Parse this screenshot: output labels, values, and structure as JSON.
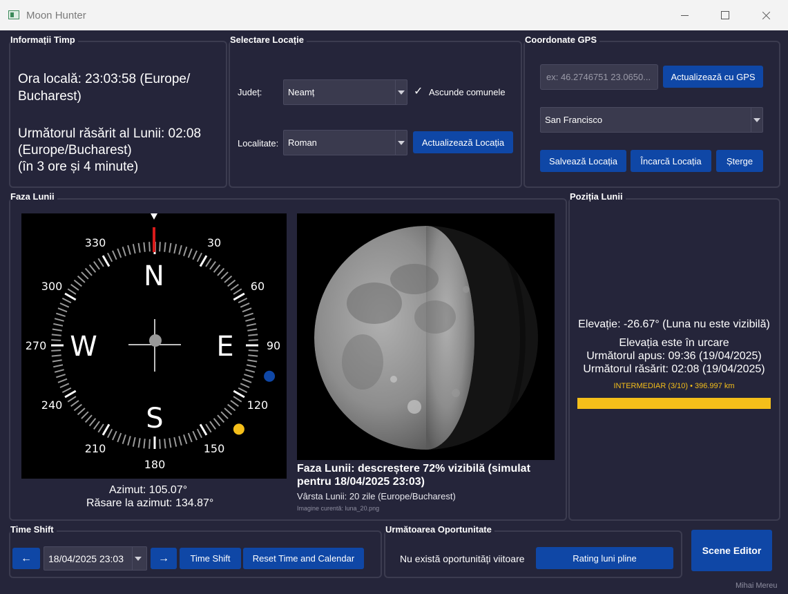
{
  "window": {
    "title": "Moon Hunter"
  },
  "time_info": {
    "group_title": "Informații Timp",
    "local_time_line1": "Ora locală: 23:03:58 (Europe/",
    "local_time_line2": "Bucharest)",
    "next_rise_line1": "Următorul răsărit al Lunii: 02:08",
    "next_rise_line2": "(Europe/Bucharest)",
    "next_rise_line3": "(în 3 ore și 4 minute)"
  },
  "location": {
    "group_title": "Selectare Locație",
    "county_label": "Județ:",
    "county_value": "Neamț",
    "hide_communes_label": "Ascunde comunele",
    "hide_communes_checked": true,
    "locality_label": "Localitate:",
    "locality_value": "Roman",
    "update_button": "Actualizează Locația"
  },
  "gps": {
    "group_title": "Coordonate GPS",
    "coords_placeholder": "ex: 46.2746751 23.0650...",
    "update_gps_button": "Actualizează cu GPS",
    "saved_location_value": "San Francisco",
    "save_button": "Salvează Locația",
    "load_button": "Încarcă Locația",
    "delete_button": "Șterge"
  },
  "moon_phase": {
    "group_title": "Faza Lunii",
    "compass": {
      "cardinals": [
        "N",
        "E",
        "S",
        "W"
      ],
      "degree_labels": [
        "30",
        "60",
        "90",
        "120",
        "150",
        "180",
        "210",
        "240",
        "270",
        "300",
        "330"
      ],
      "moon_azimuth_deg": 105.07,
      "rise_azimuth_deg": 134.87,
      "moon_marker_color": "#0f47a6",
      "rise_marker_color": "#f5bf1a"
    },
    "azimuth_text": "Azimut: 105.07°",
    "rise_azimuth_text": "Răsare la azimut: 134.87°",
    "phase_title_line1": "Faza Lunii: descreștere 72% vizibilă (simulat",
    "phase_title_line2": "pentru 18/04/2025 23:03)",
    "moon_age": "Vârsta Lunii: 20 zile (Europe/Bucharest)",
    "current_image": "Imagine curentă: luna_20.png"
  },
  "moon_position": {
    "group_title": "Poziția Lunii",
    "elevation": "Elevație: -26.67° (Luna nu este vizibilă)",
    "trend": "Elevația este în urcare",
    "next_set": "Următorul apus: 09:36 (19/04/2025)",
    "next_rise": "Următorul răsărit: 02:08 (19/04/2025)",
    "distance_label": "INTERMEDIAR (3/10) • 396.997 km",
    "distance_bar_color": "#f5bf1a"
  },
  "time_shift": {
    "group_title": "Time Shift",
    "prev_button": "←",
    "datetime_value": "18/04/2025 23:03",
    "next_button": "→",
    "shift_button": "Time Shift",
    "reset_button": "Reset Time and Calendar"
  },
  "opportunity": {
    "group_title": "Următoarea Oportunitate",
    "message": "Nu există oportunități viitoare",
    "rating_button": "Rating luni pline"
  },
  "scene_editor_button": "Scene Editor",
  "author": "Mihai Mereu"
}
